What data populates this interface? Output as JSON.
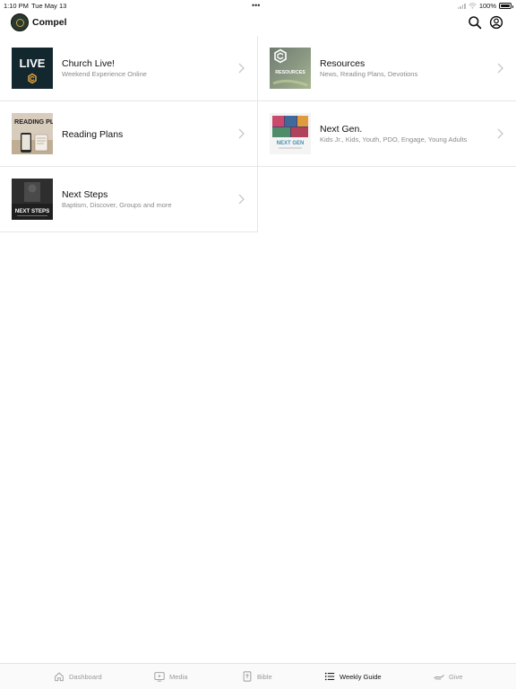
{
  "status": {
    "time": "1:10 PM",
    "date": "Tue May 13",
    "dots": "•••",
    "battery": "100%",
    "battery_level": 1.0
  },
  "header": {
    "title": "Compel"
  },
  "tiles": [
    {
      "title": "Church Live!",
      "subtitle": "Weekend Experience Online",
      "thumb_text": "LIVE"
    },
    {
      "title": "Resources",
      "subtitle": "News, Reading Plans, Devotions",
      "thumb_text": "RESOURCES"
    },
    {
      "title": "Reading Plans",
      "subtitle": "",
      "thumb_text": "READING PLANS"
    },
    {
      "title": "Next Gen.",
      "subtitle": "Kids Jr., Kids, Youth, PDO, Engage, Young Adults",
      "thumb_text": "NEXT GEN"
    },
    {
      "title": "Next Steps",
      "subtitle": "Baptism, Discover, Groups and more",
      "thumb_text": "NEXT STEPS"
    }
  ],
  "tabbar": {
    "tabs": [
      {
        "label": "Dashboard",
        "icon": "house-icon",
        "active": false
      },
      {
        "label": "Media",
        "icon": "play-screen-icon",
        "active": false
      },
      {
        "label": "Bible",
        "icon": "book-cross-icon",
        "active": false
      },
      {
        "label": "Weekly Guide",
        "icon": "list-icon",
        "active": true
      },
      {
        "label": "Give",
        "icon": "hand-give-icon",
        "active": false
      }
    ]
  },
  "colors": {
    "logo_bg": "#2b3a2f",
    "logo_ring": "#c9a64a",
    "inactive_tab": "#9a9a9a",
    "active_tab": "#111111",
    "subtitle": "#8a8a8a",
    "divider": "#e6e6e6"
  }
}
